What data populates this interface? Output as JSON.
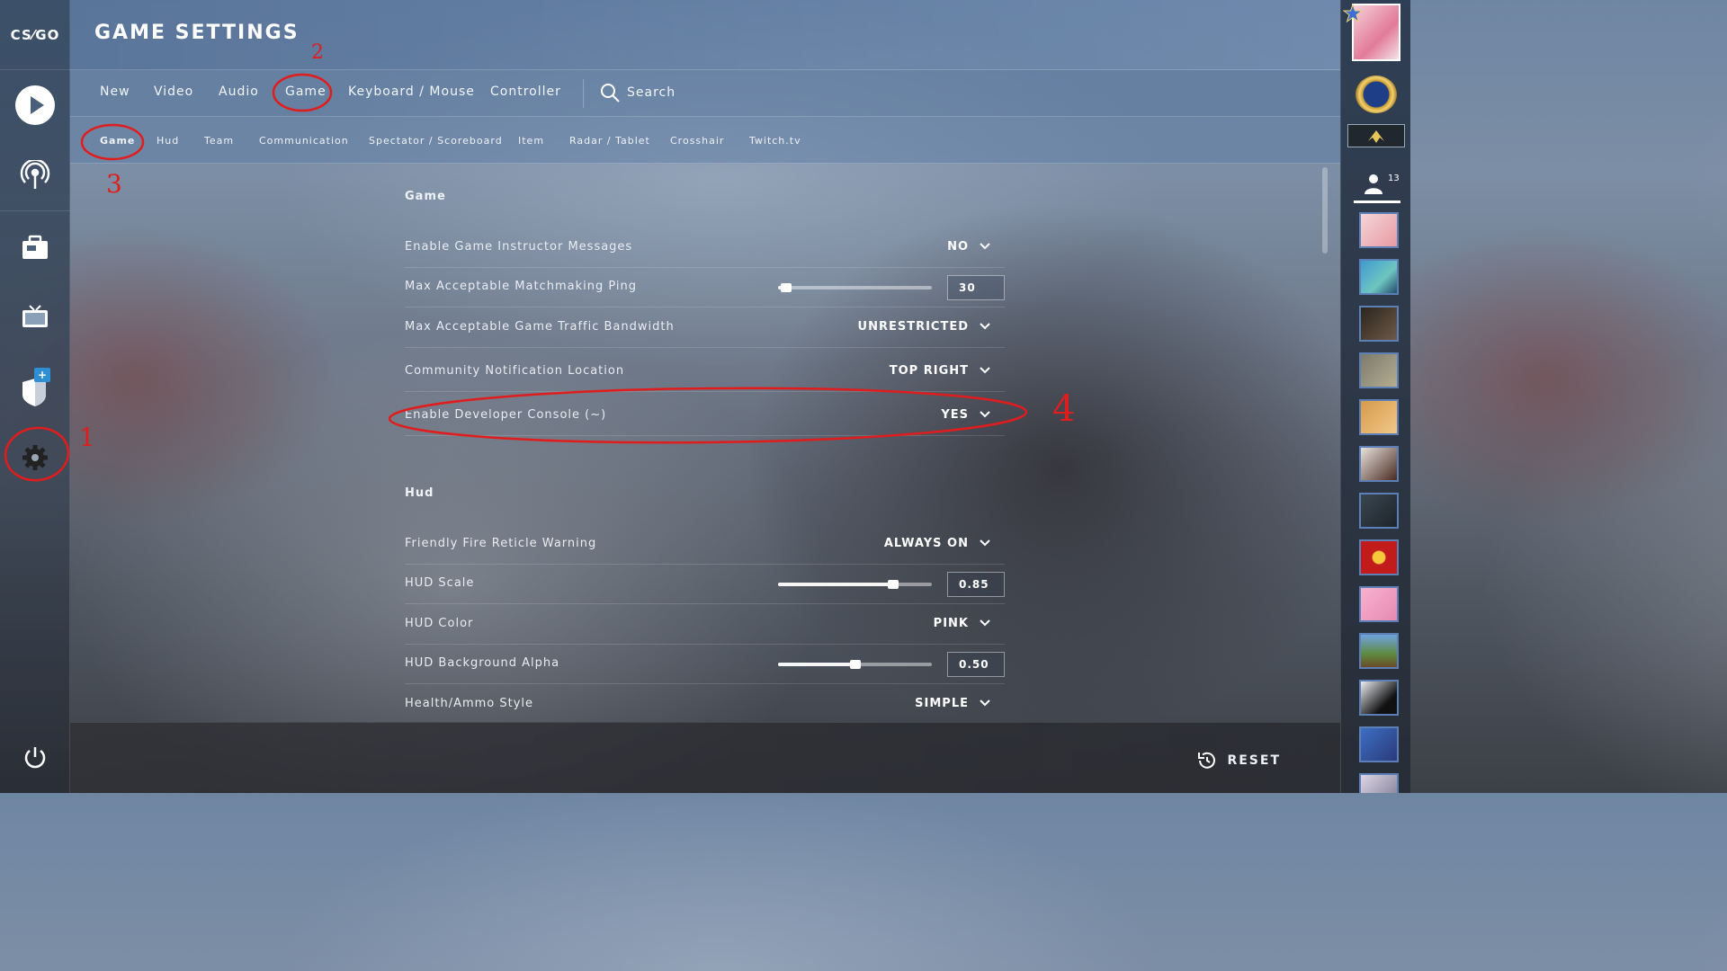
{
  "sidebar": {
    "logo_text": "CS⁄GO",
    "items": [
      {
        "name": "play",
        "icon": "play-icon"
      },
      {
        "name": "broadcast",
        "icon": "broadcast-icon"
      },
      {
        "name": "inventory",
        "icon": "briefcase-icon"
      },
      {
        "name": "watch",
        "icon": "tv-icon"
      },
      {
        "name": "operation",
        "icon": "shield-icon",
        "badge": "+"
      },
      {
        "name": "settings",
        "icon": "gear-icon"
      },
      {
        "name": "power",
        "icon": "power-icon"
      }
    ]
  },
  "header": {
    "title": "GAME SETTINGS"
  },
  "main_tabs": [
    {
      "label": "New"
    },
    {
      "label": "Video"
    },
    {
      "label": "Audio"
    },
    {
      "label": "Game"
    },
    {
      "label": "Keyboard / Mouse"
    },
    {
      "label": "Controller"
    },
    {
      "label": "Search"
    }
  ],
  "sub_tabs": [
    {
      "label": "Game"
    },
    {
      "label": "Hud"
    },
    {
      "label": "Team"
    },
    {
      "label": "Communication"
    },
    {
      "label": "Spectator / Scoreboard"
    },
    {
      "label": "Item"
    },
    {
      "label": "Radar / Tablet"
    },
    {
      "label": "Crosshair"
    },
    {
      "label": "Twitch.tv"
    }
  ],
  "sections": {
    "game": {
      "title": "Game",
      "rows": [
        {
          "label": "Enable Game Instructor Messages",
          "value": "NO"
        },
        {
          "label": "Max Acceptable Matchmaking Ping",
          "value": "30",
          "slider_fraction": 0.05
        },
        {
          "label": "Max Acceptable Game Traffic Bandwidth",
          "value": "UNRESTRICTED"
        },
        {
          "label": "Community Notification Location",
          "value": "TOP RIGHT"
        },
        {
          "label": "Enable Developer Console (~)",
          "value": "YES"
        }
      ]
    },
    "hud": {
      "title": "Hud",
      "rows": [
        {
          "label": "Friendly Fire Reticle Warning",
          "value": "ALWAYS ON"
        },
        {
          "label": "HUD Scale",
          "value": "0.85",
          "slider_fraction": 0.75
        },
        {
          "label": "HUD Color",
          "value": "PINK"
        },
        {
          "label": "HUD Background Alpha",
          "value": "0.50",
          "slider_fraction": 0.5
        },
        {
          "label": "Health/Ammo Style",
          "value": "SIMPLE"
        }
      ]
    }
  },
  "footer": {
    "reset_label": "RESET"
  },
  "rightbar": {
    "friends_count": "13"
  },
  "annotations": [
    "1",
    "2",
    "3",
    "4"
  ],
  "colors": {
    "annotation": "#e11c1c",
    "friend_border": "#5c7fb5",
    "badge": "#2f8fd3"
  }
}
